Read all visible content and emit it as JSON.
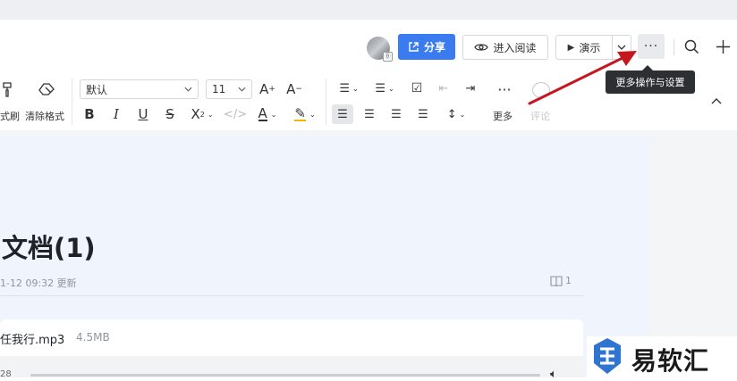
{
  "header": {
    "share_label": "分享",
    "read_mode_label": "进入阅读",
    "present_label": "演示",
    "more_tooltip": "更多操作与设置"
  },
  "toolbar": {
    "format_painter_label": "式刷",
    "clear_format_label": "清除格式",
    "font_value": "默认",
    "size_value": "11",
    "more_label": "更多",
    "comment_label": "评论"
  },
  "document": {
    "title": "文档(1)",
    "meta_time": "1-12 09:32 更新",
    "read_count": "1",
    "attachment_name": "任我行.mp3",
    "attachment_size": "4.5MB",
    "player_time": "28"
  },
  "watermark": {
    "text": "易软汇"
  },
  "colors": {
    "accent": "#3a7bf0",
    "arrow": "#c4171f",
    "paper": "#eff4fd"
  }
}
